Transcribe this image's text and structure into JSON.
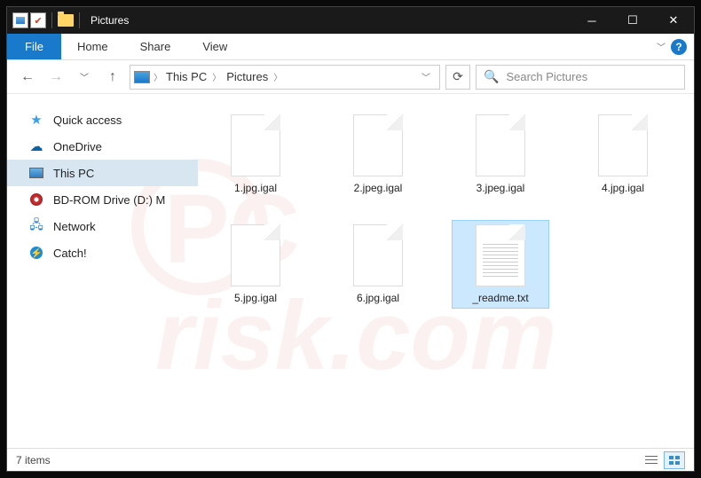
{
  "title": "Pictures",
  "ribbon": {
    "file": "File",
    "tabs": [
      "Home",
      "Share",
      "View"
    ]
  },
  "breadcrumb": [
    "This PC",
    "Pictures"
  ],
  "search": {
    "placeholder": "Search Pictures"
  },
  "sidebar": {
    "items": [
      {
        "label": "Quick access",
        "icon": "star"
      },
      {
        "label": "OneDrive",
        "icon": "cloud"
      },
      {
        "label": "This PC",
        "icon": "pc",
        "selected": true
      },
      {
        "label": "BD-ROM Drive (D:) M",
        "icon": "disc"
      },
      {
        "label": "Network",
        "icon": "net"
      },
      {
        "label": "Catch!",
        "icon": "catch"
      }
    ]
  },
  "files": [
    {
      "name": "1.jpg.igal",
      "type": "blank"
    },
    {
      "name": "2.jpeg.igal",
      "type": "blank"
    },
    {
      "name": "3.jpeg.igal",
      "type": "blank"
    },
    {
      "name": "4.jpg.igal",
      "type": "blank"
    },
    {
      "name": "5.jpg.igal",
      "type": "blank"
    },
    {
      "name": "6.jpg.igal",
      "type": "blank"
    },
    {
      "name": "_readme.txt",
      "type": "txt",
      "selected": true
    }
  ],
  "status": {
    "count_label": "7 items"
  }
}
